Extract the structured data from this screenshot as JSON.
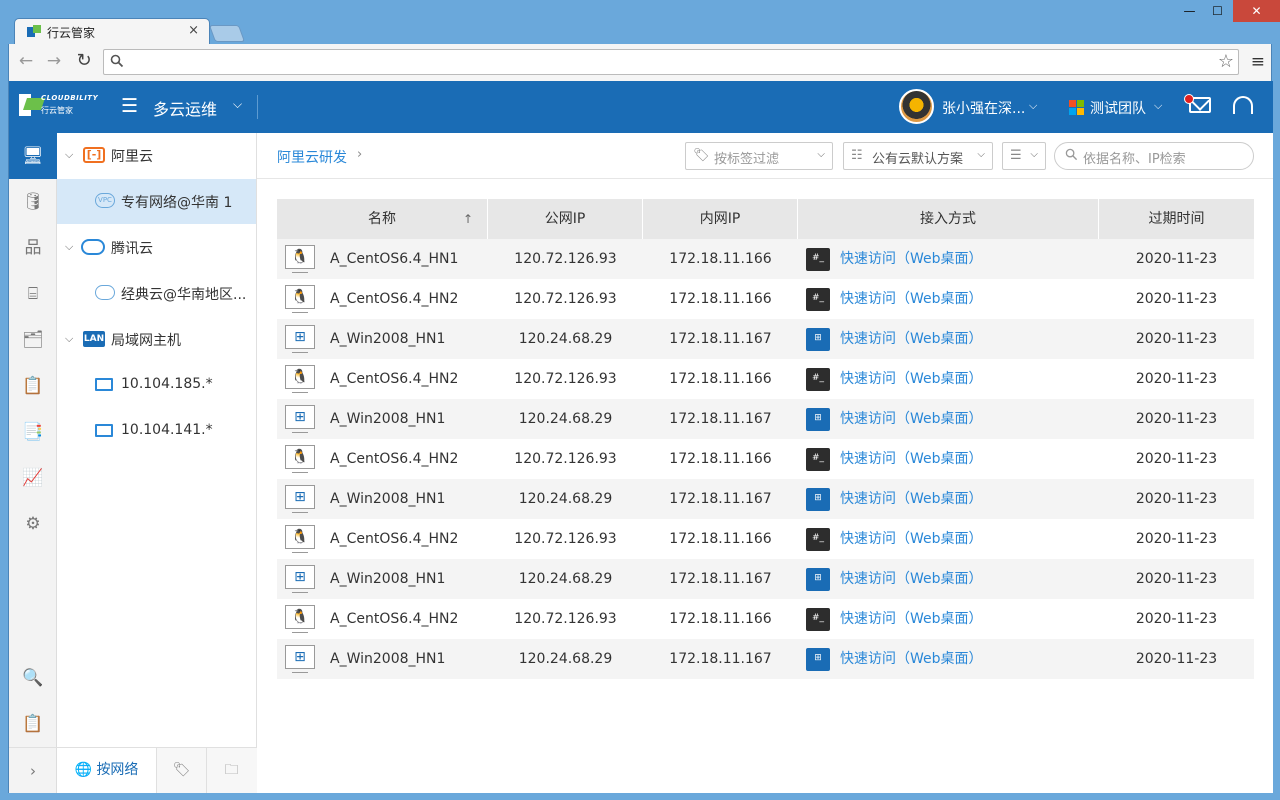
{
  "browser": {
    "tab_title": "行云管家",
    "tab_close": "×",
    "win_min": "—",
    "win_max": "☐",
    "win_close": "✕",
    "nav_back": "←",
    "nav_forward": "→",
    "nav_reload": "↻",
    "address_value": "",
    "star": "☆",
    "menu": "≡"
  },
  "header": {
    "logo_text": "CLOUDBILITY",
    "logo_sub": "行云管家",
    "menu_icon": "☰",
    "title": "多云运维",
    "title_chevron": "⌵",
    "user_name": "张小强在深...",
    "user_chevron": "⌵",
    "team_name": "测试团队",
    "team_chevron": "⌵",
    "brand_color": "#1a6cb5"
  },
  "rail": {
    "items": [
      "🖥",
      "🛢",
      "品",
      "⌸",
      "🗂",
      "📋",
      "📑",
      "📈",
      "⚙"
    ],
    "bottom": [
      "🔍",
      "📋"
    ],
    "expand": "›"
  },
  "tree": {
    "groups": [
      {
        "label": "阿里云",
        "caret": "⌵",
        "icon_text": "[-]",
        "children": [
          {
            "label": "专有网络@华南 1",
            "icon_text": "VPC"
          }
        ]
      },
      {
        "label": "腾讯云",
        "caret": "⌵",
        "children": [
          {
            "label": "经典云@华南地区..."
          }
        ]
      },
      {
        "label": "局域网主机",
        "caret": "⌵",
        "icon_text": "LAN",
        "children": [
          {
            "label": "10.104.185.*"
          },
          {
            "label": "10.104.141.*"
          }
        ]
      }
    ],
    "bottom_tabs": {
      "network_icon": "🌐",
      "network": "按网络",
      "tag": "🏷",
      "folder": "🗀"
    }
  },
  "main": {
    "breadcrumb": "阿里云研发",
    "breadcrumb_sep": "›",
    "filter_tag_placeholder": "按标签过滤",
    "filter_plan": "公有云默认方案",
    "search_placeholder": "依据名称、IP检索",
    "filter_chevron": "⌵",
    "tag_icon": "🏷",
    "plan_icon": "☷",
    "sort_icon": "☰",
    "search_icon": "○"
  },
  "table": {
    "columns": [
      "名称",
      "公网IP",
      "内网IP",
      "接入方式",
      "过期时间"
    ],
    "sort_arrow": "↑",
    "access_text": "快速访问（Web桌面）",
    "rows": [
      {
        "os": "linux",
        "name": "A_CentOS6.4_HN1",
        "public_ip": "120.72.126.93",
        "private_ip": "172.18.11.166",
        "expire": "2020-11-23"
      },
      {
        "os": "linux",
        "name": "A_CentOS6.4_HN2",
        "public_ip": "120.72.126.93",
        "private_ip": "172.18.11.166",
        "expire": "2020-11-23"
      },
      {
        "os": "windows",
        "name": "A_Win2008_HN1",
        "public_ip": "120.24.68.29",
        "private_ip": "172.18.11.167",
        "expire": "2020-11-23"
      },
      {
        "os": "linux",
        "name": "A_CentOS6.4_HN2",
        "public_ip": "120.72.126.93",
        "private_ip": "172.18.11.166",
        "expire": "2020-11-23"
      },
      {
        "os": "windows",
        "name": "A_Win2008_HN1",
        "public_ip": "120.24.68.29",
        "private_ip": "172.18.11.167",
        "expire": "2020-11-23"
      },
      {
        "os": "linux",
        "name": "A_CentOS6.4_HN2",
        "public_ip": "120.72.126.93",
        "private_ip": "172.18.11.166",
        "expire": "2020-11-23"
      },
      {
        "os": "windows",
        "name": "A_Win2008_HN1",
        "public_ip": "120.24.68.29",
        "private_ip": "172.18.11.167",
        "expire": "2020-11-23"
      },
      {
        "os": "linux",
        "name": "A_CentOS6.4_HN2",
        "public_ip": "120.72.126.93",
        "private_ip": "172.18.11.166",
        "expire": "2020-11-23"
      },
      {
        "os": "windows",
        "name": "A_Win2008_HN1",
        "public_ip": "120.24.68.29",
        "private_ip": "172.18.11.167",
        "expire": "2020-11-23"
      },
      {
        "os": "linux",
        "name": "A_CentOS6.4_HN2",
        "public_ip": "120.72.126.93",
        "private_ip": "172.18.11.166",
        "expire": "2020-11-23"
      },
      {
        "os": "windows",
        "name": "A_Win2008_HN1",
        "public_ip": "120.24.68.29",
        "private_ip": "172.18.11.167",
        "expire": "2020-11-23"
      }
    ]
  }
}
